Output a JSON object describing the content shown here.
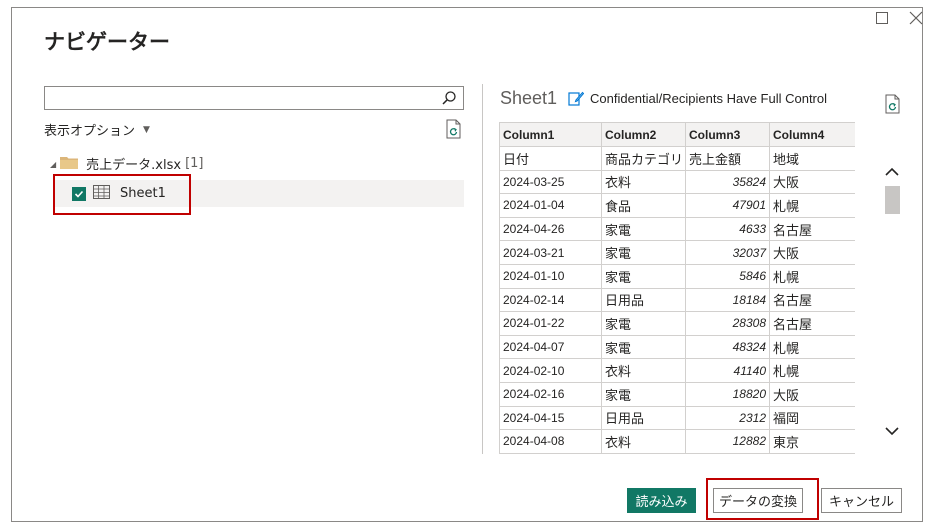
{
  "dialog": {
    "title": "ナビゲーター"
  },
  "search": {
    "placeholder": "",
    "value": ""
  },
  "display_options_label": "表示オプション",
  "tree": {
    "file_name": "売上データ.xlsx",
    "file_count": "[1]",
    "sheet_name": "Sheet1",
    "sheet_checked": true
  },
  "preview": {
    "title": "Sheet1",
    "permission_label": "Confidential/Recipients Have Full Control",
    "headers": [
      "Column1",
      "Column2",
      "Column3",
      "Column4"
    ],
    "rows": [
      [
        "日付",
        "商品カテゴリ",
        "売上金額",
        "地域"
      ],
      [
        "2024-03-25",
        "衣料",
        "35824",
        "大阪"
      ],
      [
        "2024-01-04",
        "食品",
        "47901",
        "札幌"
      ],
      [
        "2024-04-26",
        "家電",
        "4633",
        "名古屋"
      ],
      [
        "2024-03-21",
        "家電",
        "32037",
        "大阪"
      ],
      [
        "2024-01-10",
        "家電",
        "5846",
        "札幌"
      ],
      [
        "2024-02-14",
        "日用品",
        "18184",
        "名古屋"
      ],
      [
        "2024-01-22",
        "家電",
        "28308",
        "名古屋"
      ],
      [
        "2024-04-07",
        "家電",
        "48324",
        "札幌"
      ],
      [
        "2024-02-10",
        "衣料",
        "41140",
        "札幌"
      ],
      [
        "2024-02-16",
        "家電",
        "18820",
        "大阪"
      ],
      [
        "2024-04-15",
        "日用品",
        "2312",
        "福岡"
      ],
      [
        "2024-04-08",
        "衣料",
        "12882",
        "東京"
      ]
    ]
  },
  "buttons": {
    "load": "読み込み",
    "transform": "データの変換",
    "cancel": "キャンセル"
  },
  "colors": {
    "accent": "#117865",
    "highlight": "#c00000",
    "border": "#8a8886"
  }
}
